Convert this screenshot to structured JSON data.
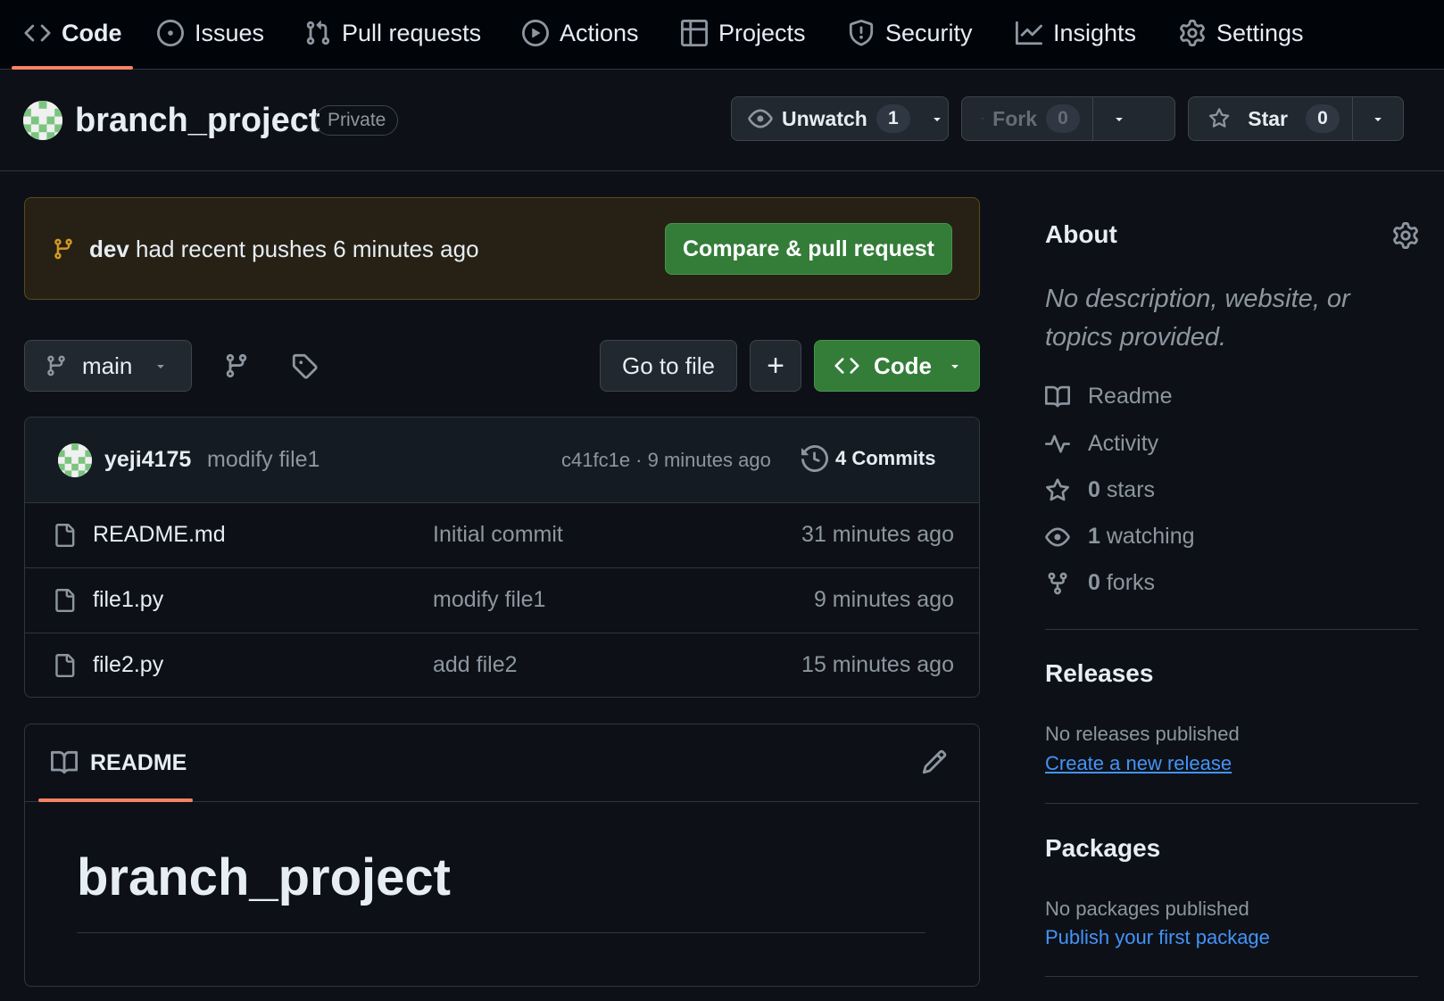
{
  "nav": {
    "tabs": [
      {
        "label": "Code",
        "icon": "code-icon"
      },
      {
        "label": "Issues",
        "icon": "issue-icon"
      },
      {
        "label": "Pull requests",
        "icon": "pull-request-icon"
      },
      {
        "label": "Actions",
        "icon": "play-icon"
      },
      {
        "label": "Projects",
        "icon": "table-icon"
      },
      {
        "label": "Security",
        "icon": "shield-icon"
      },
      {
        "label": "Insights",
        "icon": "graph-icon"
      },
      {
        "label": "Settings",
        "icon": "gear-icon"
      }
    ],
    "selected": "Code"
  },
  "repo": {
    "name": "branch_project",
    "visibility": "Private",
    "unwatch_label": "Unwatch",
    "watch_count": "1",
    "fork_label": "Fork",
    "fork_count": "0",
    "star_label": "Star",
    "star_count": "0"
  },
  "banner": {
    "branch": "dev",
    "message": "had recent pushes 6 minutes ago",
    "button": "Compare & pull request"
  },
  "toolbar": {
    "branch": "main",
    "go_to_file": "Go to file",
    "add": "+",
    "code": "Code"
  },
  "latest_commit": {
    "author": "yeji4175",
    "message": "modify file1",
    "sha_time": "c41fc1e · 9 minutes ago",
    "commits": "4 Commits"
  },
  "files": [
    {
      "name": "README.md",
      "message": "Initial commit",
      "time": "31 minutes ago"
    },
    {
      "name": "file1.py",
      "message": "modify file1",
      "time": "9 minutes ago"
    },
    {
      "name": "file2.py",
      "message": "add file2",
      "time": "15 minutes ago"
    }
  ],
  "readme": {
    "tab": "README",
    "heading": "branch_project"
  },
  "about": {
    "title": "About",
    "description": "No description, website, or topics provided.",
    "readme": "Readme",
    "activity": "Activity",
    "stars_count": "0",
    "stars_label": "stars",
    "watching_count": "1",
    "watching_label": "watching",
    "forks_count": "0",
    "forks_label": "forks"
  },
  "releases": {
    "title": "Releases",
    "empty": "No releases published",
    "link": "Create a new release"
  },
  "packages": {
    "title": "Packages",
    "empty": "No packages published",
    "link": "Publish your first package"
  },
  "colors": {
    "background": "#0d1117",
    "accent_underline": "#f78166",
    "primary_button": "#347d39",
    "link": "#4493f8",
    "banner_bg": "#272115"
  }
}
